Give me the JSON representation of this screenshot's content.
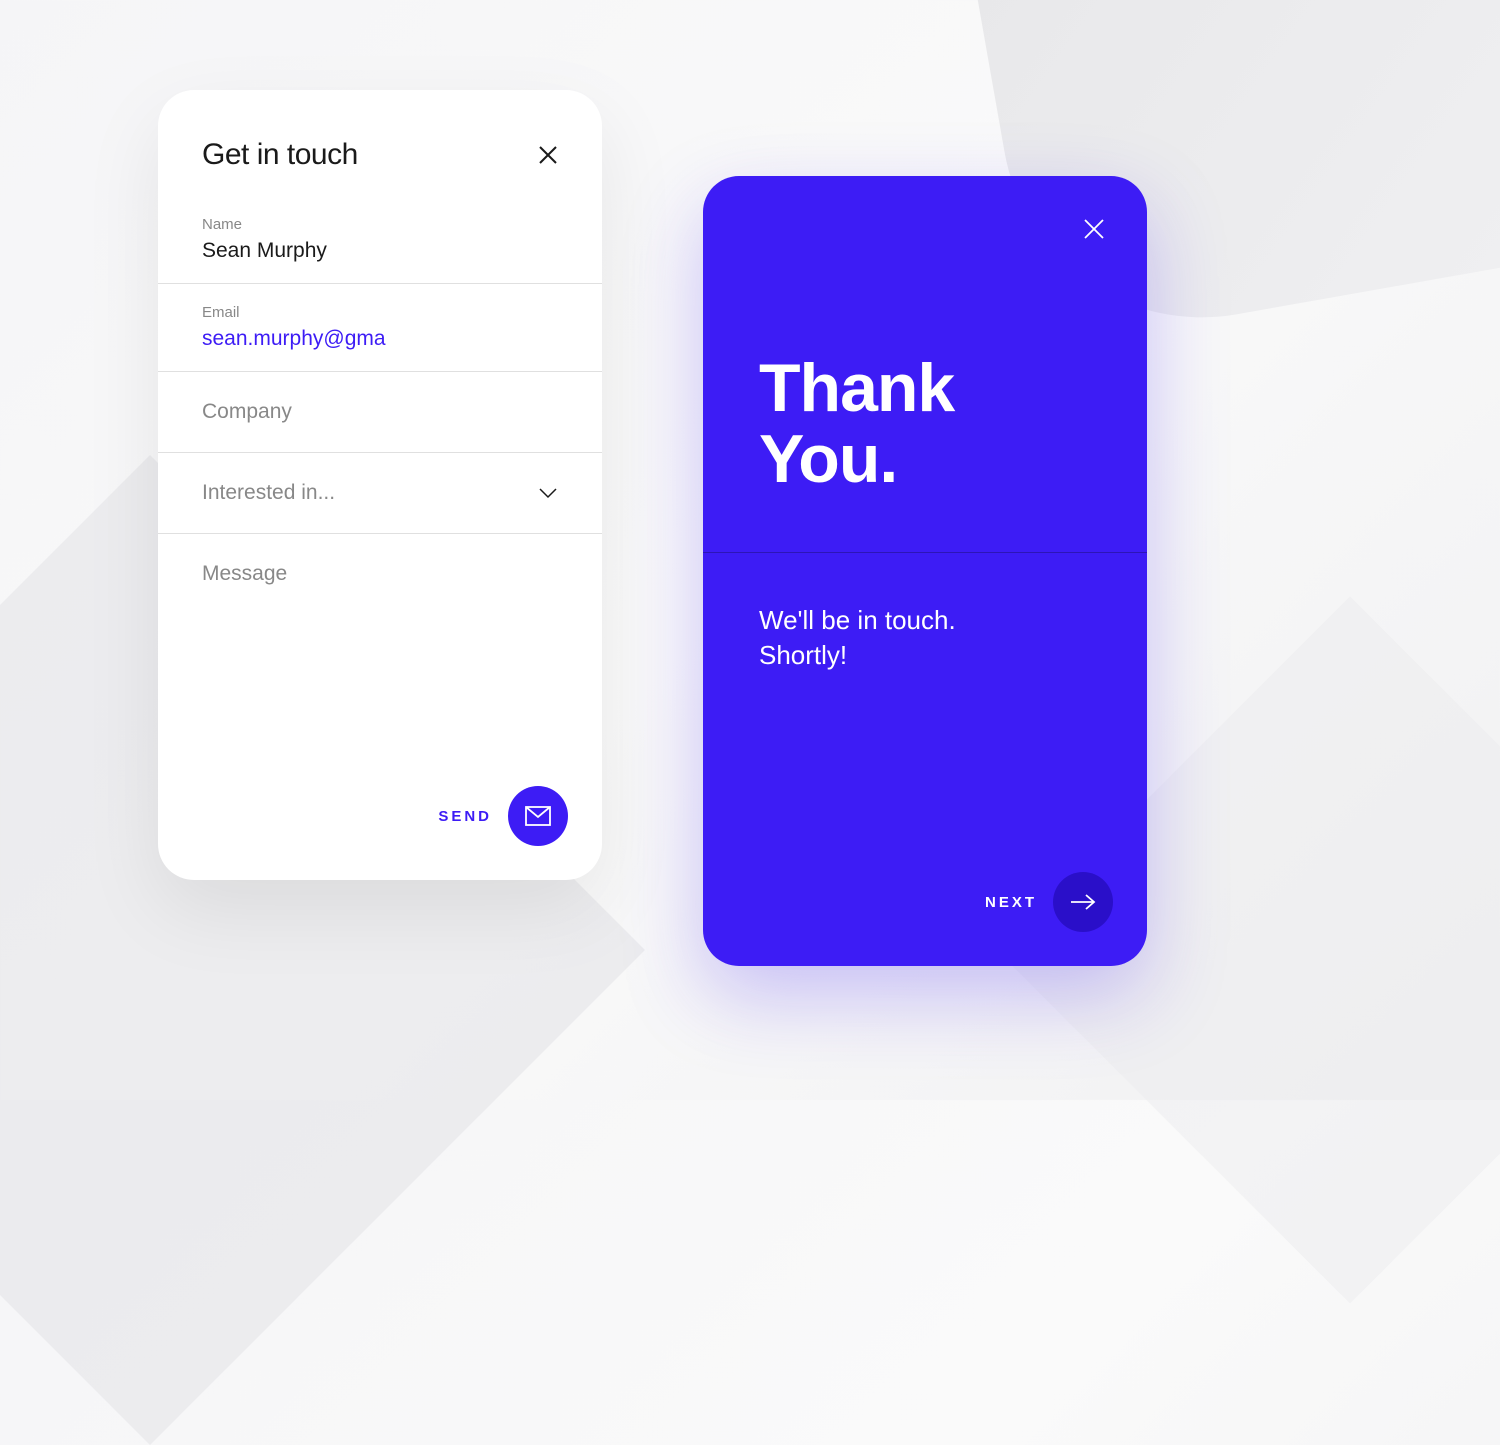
{
  "colors": {
    "accent": "#3d1cf5",
    "accentDark": "#2a0fc9"
  },
  "formCard": {
    "title": "Get in touch",
    "fields": {
      "name": {
        "label": "Name",
        "value": "Sean Murphy"
      },
      "email": {
        "label": "Email",
        "value": "sean.murphy@gma"
      },
      "company": {
        "placeholder": "Company"
      },
      "interest": {
        "placeholder": "Interested in..."
      },
      "message": {
        "placeholder": "Message"
      }
    },
    "sendLabel": "SEND"
  },
  "thanksCard": {
    "titleLine1": "Thank",
    "titleLine2": "You.",
    "subtitleLine1": "We'll be in touch.",
    "subtitleLine2": "Shortly!",
    "nextLabel": "NEXT"
  }
}
